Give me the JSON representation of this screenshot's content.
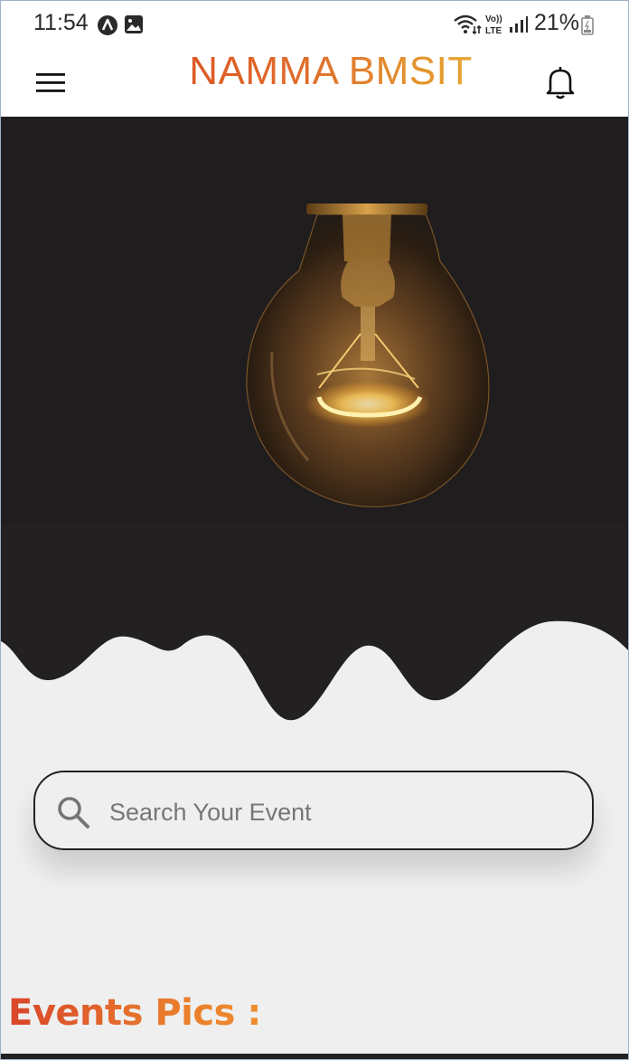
{
  "status_bar": {
    "time": "11:54",
    "battery": "21%",
    "icons": [
      "app-notification-icon",
      "gallery-icon",
      "wifi-icon",
      "volte-lte-icon",
      "signal-icon",
      "battery-icon"
    ]
  },
  "app_bar": {
    "title": "NAMMA BMSIT",
    "menu_icon": "hamburger-menu-icon",
    "notification_icon": "bell-icon"
  },
  "hero": {
    "image": "light-bulb-illustration",
    "background_color": "#222021",
    "wave_color": "#efefef"
  },
  "search": {
    "placeholder": "Search Your Event",
    "value": ""
  },
  "sections": {
    "events_pics_title": "Events Pics :"
  },
  "colors": {
    "title_gradient_start": "#d63a1f",
    "title_gradient_end": "#ead23a",
    "section_title": "#e0602a"
  }
}
